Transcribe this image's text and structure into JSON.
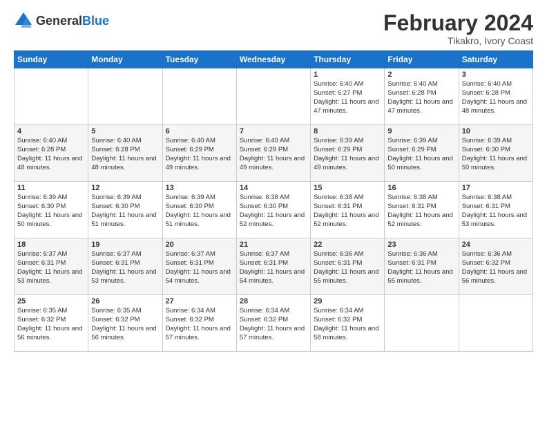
{
  "logo": {
    "general": "General",
    "blue": "Blue"
  },
  "title": "February 2024",
  "subtitle": "Tikakro, Ivory Coast",
  "headers": [
    "Sunday",
    "Monday",
    "Tuesday",
    "Wednesday",
    "Thursday",
    "Friday",
    "Saturday"
  ],
  "weeks": [
    [
      {
        "day": "",
        "sunrise": "",
        "sunset": "",
        "daylight": ""
      },
      {
        "day": "",
        "sunrise": "",
        "sunset": "",
        "daylight": ""
      },
      {
        "day": "",
        "sunrise": "",
        "sunset": "",
        "daylight": ""
      },
      {
        "day": "",
        "sunrise": "",
        "sunset": "",
        "daylight": ""
      },
      {
        "day": "1",
        "sunrise": "Sunrise: 6:40 AM",
        "sunset": "Sunset: 6:27 PM",
        "daylight": "Daylight: 11 hours and 47 minutes."
      },
      {
        "day": "2",
        "sunrise": "Sunrise: 6:40 AM",
        "sunset": "Sunset: 6:28 PM",
        "daylight": "Daylight: 11 hours and 47 minutes."
      },
      {
        "day": "3",
        "sunrise": "Sunrise: 6:40 AM",
        "sunset": "Sunset: 6:28 PM",
        "daylight": "Daylight: 11 hours and 48 minutes."
      }
    ],
    [
      {
        "day": "4",
        "sunrise": "Sunrise: 6:40 AM",
        "sunset": "Sunset: 6:28 PM",
        "daylight": "Daylight: 11 hours and 48 minutes."
      },
      {
        "day": "5",
        "sunrise": "Sunrise: 6:40 AM",
        "sunset": "Sunset: 6:28 PM",
        "daylight": "Daylight: 11 hours and 48 minutes."
      },
      {
        "day": "6",
        "sunrise": "Sunrise: 6:40 AM",
        "sunset": "Sunset: 6:29 PM",
        "daylight": "Daylight: 11 hours and 49 minutes."
      },
      {
        "day": "7",
        "sunrise": "Sunrise: 6:40 AM",
        "sunset": "Sunset: 6:29 PM",
        "daylight": "Daylight: 11 hours and 49 minutes."
      },
      {
        "day": "8",
        "sunrise": "Sunrise: 6:39 AM",
        "sunset": "Sunset: 6:29 PM",
        "daylight": "Daylight: 11 hours and 49 minutes."
      },
      {
        "day": "9",
        "sunrise": "Sunrise: 6:39 AM",
        "sunset": "Sunset: 6:29 PM",
        "daylight": "Daylight: 11 hours and 50 minutes."
      },
      {
        "day": "10",
        "sunrise": "Sunrise: 6:39 AM",
        "sunset": "Sunset: 6:30 PM",
        "daylight": "Daylight: 11 hours and 50 minutes."
      }
    ],
    [
      {
        "day": "11",
        "sunrise": "Sunrise: 6:39 AM",
        "sunset": "Sunset: 6:30 PM",
        "daylight": "Daylight: 11 hours and 50 minutes."
      },
      {
        "day": "12",
        "sunrise": "Sunrise: 6:39 AM",
        "sunset": "Sunset: 6:30 PM",
        "daylight": "Daylight: 11 hours and 51 minutes."
      },
      {
        "day": "13",
        "sunrise": "Sunrise: 6:39 AM",
        "sunset": "Sunset: 6:30 PM",
        "daylight": "Daylight: 11 hours and 51 minutes."
      },
      {
        "day": "14",
        "sunrise": "Sunrise: 6:38 AM",
        "sunset": "Sunset: 6:30 PM",
        "daylight": "Daylight: 11 hours and 52 minutes."
      },
      {
        "day": "15",
        "sunrise": "Sunrise: 6:38 AM",
        "sunset": "Sunset: 6:31 PM",
        "daylight": "Daylight: 11 hours and 52 minutes."
      },
      {
        "day": "16",
        "sunrise": "Sunrise: 6:38 AM",
        "sunset": "Sunset: 6:31 PM",
        "daylight": "Daylight: 11 hours and 52 minutes."
      },
      {
        "day": "17",
        "sunrise": "Sunrise: 6:38 AM",
        "sunset": "Sunset: 6:31 PM",
        "daylight": "Daylight: 11 hours and 53 minutes."
      }
    ],
    [
      {
        "day": "18",
        "sunrise": "Sunrise: 6:37 AM",
        "sunset": "Sunset: 6:31 PM",
        "daylight": "Daylight: 11 hours and 53 minutes."
      },
      {
        "day": "19",
        "sunrise": "Sunrise: 6:37 AM",
        "sunset": "Sunset: 6:31 PM",
        "daylight": "Daylight: 11 hours and 53 minutes."
      },
      {
        "day": "20",
        "sunrise": "Sunrise: 6:37 AM",
        "sunset": "Sunset: 6:31 PM",
        "daylight": "Daylight: 11 hours and 54 minutes."
      },
      {
        "day": "21",
        "sunrise": "Sunrise: 6:37 AM",
        "sunset": "Sunset: 6:31 PM",
        "daylight": "Daylight: 11 hours and 54 minutes."
      },
      {
        "day": "22",
        "sunrise": "Sunrise: 6:36 AM",
        "sunset": "Sunset: 6:31 PM",
        "daylight": "Daylight: 11 hours and 55 minutes."
      },
      {
        "day": "23",
        "sunrise": "Sunrise: 6:36 AM",
        "sunset": "Sunset: 6:31 PM",
        "daylight": "Daylight: 11 hours and 55 minutes."
      },
      {
        "day": "24",
        "sunrise": "Sunrise: 6:36 AM",
        "sunset": "Sunset: 6:32 PM",
        "daylight": "Daylight: 11 hours and 56 minutes."
      }
    ],
    [
      {
        "day": "25",
        "sunrise": "Sunrise: 6:35 AM",
        "sunset": "Sunset: 6:32 PM",
        "daylight": "Daylight: 11 hours and 56 minutes."
      },
      {
        "day": "26",
        "sunrise": "Sunrise: 6:35 AM",
        "sunset": "Sunset: 6:32 PM",
        "daylight": "Daylight: 11 hours and 56 minutes."
      },
      {
        "day": "27",
        "sunrise": "Sunrise: 6:34 AM",
        "sunset": "Sunset: 6:32 PM",
        "daylight": "Daylight: 11 hours and 57 minutes."
      },
      {
        "day": "28",
        "sunrise": "Sunrise: 6:34 AM",
        "sunset": "Sunset: 6:32 PM",
        "daylight": "Daylight: 11 hours and 57 minutes."
      },
      {
        "day": "29",
        "sunrise": "Sunrise: 6:34 AM",
        "sunset": "Sunset: 6:32 PM",
        "daylight": "Daylight: 11 hours and 58 minutes."
      },
      {
        "day": "",
        "sunrise": "",
        "sunset": "",
        "daylight": ""
      },
      {
        "day": "",
        "sunrise": "",
        "sunset": "",
        "daylight": ""
      }
    ]
  ]
}
